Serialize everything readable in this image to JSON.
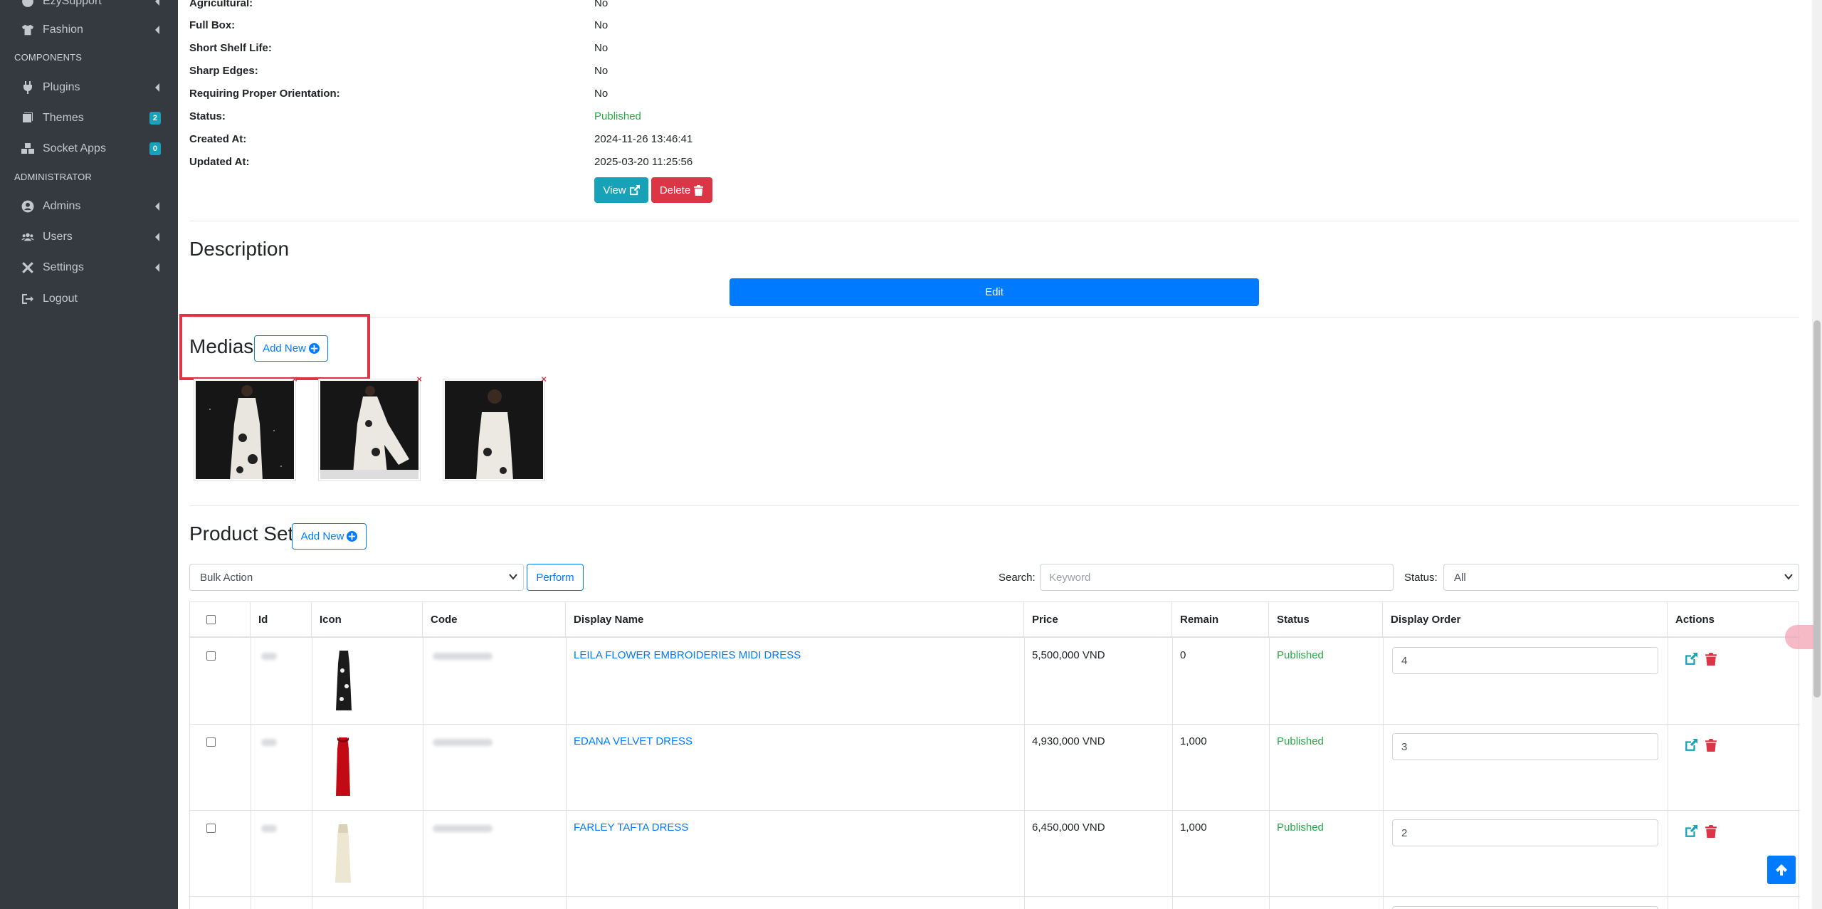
{
  "sidebar": {
    "items": [
      {
        "label": "EzySupport",
        "icon": "support-icon",
        "has_chevron": true
      },
      {
        "label": "Fashion",
        "icon": "shirt-icon",
        "has_chevron": true
      }
    ],
    "components_header": "COMPONENTS",
    "components": [
      {
        "label": "Plugins",
        "icon": "plug-icon",
        "has_chevron": true
      },
      {
        "label": "Themes",
        "icon": "book-icon",
        "badge": "2"
      },
      {
        "label": "Socket Apps",
        "icon": "cubes-icon",
        "badge": "0"
      }
    ],
    "admin_header": "ADMINISTRATOR",
    "admin": [
      {
        "label": "Admins",
        "icon": "user-circle-icon",
        "has_chevron": true
      },
      {
        "label": "Users",
        "icon": "users-icon",
        "has_chevron": true
      },
      {
        "label": "Settings",
        "icon": "tools-icon",
        "has_chevron": true
      },
      {
        "label": "Logout",
        "icon": "sign-out-icon"
      }
    ]
  },
  "details": [
    {
      "key": "Agricultural:",
      "value": "No"
    },
    {
      "key": "Full Box:",
      "value": "No"
    },
    {
      "key": "Short Shelf Life:",
      "value": "No"
    },
    {
      "key": "Sharp Edges:",
      "value": "No"
    },
    {
      "key": "Requiring Proper Orientation:",
      "value": "No"
    },
    {
      "key": "Status:",
      "value": "Published",
      "color": "#28a745"
    },
    {
      "key": "Created At:",
      "value": "2024-11-26 13:46:41"
    },
    {
      "key": "Updated At:",
      "value": "2025-03-20 11:25:56"
    }
  ],
  "actions": {
    "view_label": "View",
    "delete_label": "Delete"
  },
  "description": {
    "title": "Description",
    "edit_label": "Edit"
  },
  "medias": {
    "title": "Medias",
    "add_new_label": "Add New",
    "remove_mark": "×",
    "count": 3
  },
  "product_set": {
    "title": "Product Set",
    "add_new_label": "Add New",
    "bulk_action": "Bulk Action",
    "perform_label": "Perform",
    "search_label": "Search:",
    "search_placeholder": "Keyword",
    "status_label": "Status:",
    "status_value": "All",
    "columns": [
      "Id",
      "Icon",
      "Code",
      "Display Name",
      "Price",
      "Remain",
      "Status",
      "Display Order",
      "Actions"
    ],
    "rows": [
      {
        "name": "LEILA FLOWER EMBROIDERIES MIDI DRESS",
        "price": "5,500,000 VND",
        "remain": "0",
        "status": "Published",
        "order": "4",
        "icon": "dress-black-icon"
      },
      {
        "name": "EDANA VELVET DRESS",
        "price": "4,930,000 VND",
        "remain": "1,000",
        "status": "Published",
        "order": "3",
        "icon": "dress-red-icon"
      },
      {
        "name": "FARLEY TAFTA DRESS",
        "price": "6,450,000 VND",
        "remain": "1,000",
        "status": "Published",
        "order": "2",
        "icon": "dress-cream-icon"
      }
    ]
  },
  "colors": {
    "primary": "#007bff",
    "danger": "#dc3545",
    "info": "#17a2b8",
    "success": "#28a745",
    "sidebar": "#343a40"
  }
}
